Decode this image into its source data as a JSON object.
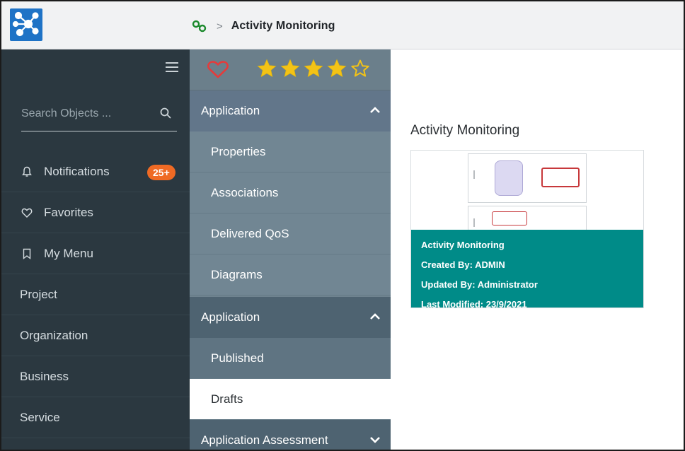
{
  "breadcrumb": {
    "current": "Activity Monitoring"
  },
  "sidebar": {
    "search": {
      "placeholder": "Search Objects ...",
      "value": ""
    },
    "items": [
      {
        "label": "Notifications",
        "icon": "bell-icon",
        "badge": "25+"
      },
      {
        "label": "Favorites",
        "icon": "heart-icon"
      },
      {
        "label": "My Menu",
        "icon": "bookmark-icon"
      },
      {
        "label": "Project"
      },
      {
        "label": "Organization"
      },
      {
        "label": "Business"
      },
      {
        "label": "Service"
      }
    ]
  },
  "panel": {
    "rating": {
      "filled_stars": 4,
      "total_stars": 5
    },
    "sections": [
      {
        "label": "Application",
        "expanded": true,
        "items": [
          "Properties",
          "Associations",
          "Delivered QoS",
          "Diagrams"
        ]
      },
      {
        "label": "Application",
        "expanded": true,
        "items": [
          "Published",
          "Drafts"
        ],
        "active_item": "Drafts"
      },
      {
        "label": "Application Assessment",
        "expanded": false
      }
    ]
  },
  "main": {
    "title": "Activity Monitoring",
    "card": {
      "name": "Activity Monitoring",
      "created_by": "Created By: ADMIN",
      "updated_by": "Updated By: Administrator",
      "last_modified": "Last Modified: 23/9/2021"
    }
  },
  "colors": {
    "sidebar": "#2b3840",
    "panel": "#6f838f",
    "badge": "#ef6a24",
    "star": "#f3c316",
    "heart": "#e53b3b",
    "card_info": "#008b88"
  }
}
